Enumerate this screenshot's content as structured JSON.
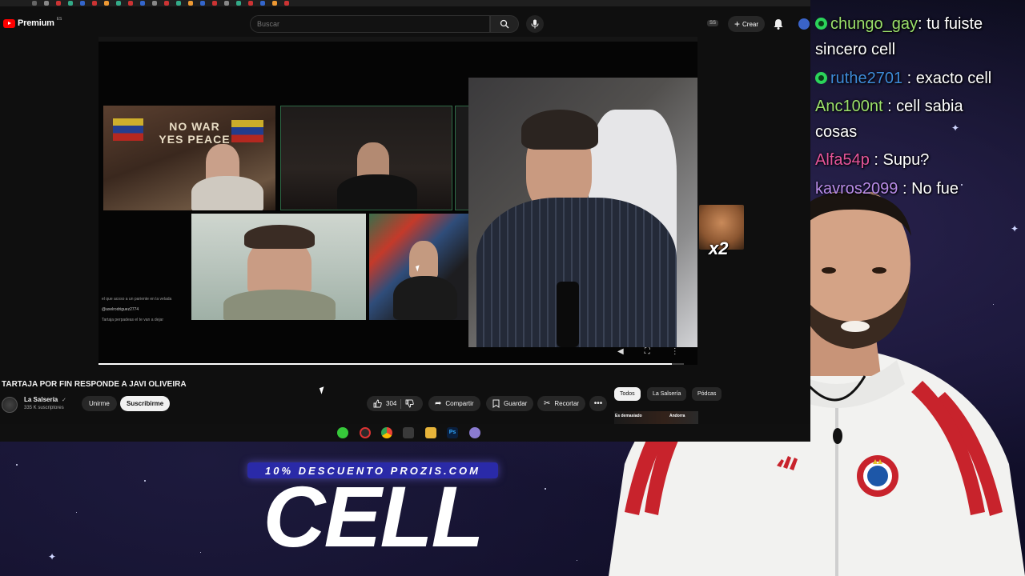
{
  "browser": {
    "youtube": {
      "brand": "Premium",
      "region": "ES",
      "search_placeholder": "Buscar",
      "ss_badge": "SS",
      "create_label": "Crear"
    },
    "video": {
      "overlay_text": "NO WAR\nYES PEACE",
      "mini_chat_line1": "el que acoso a un pariente en la velada",
      "mini_chat_user": "@axelrodriguez2774",
      "mini_chat_line2": "Tartaja perpadeas el te van a dejar",
      "progress": 0.98,
      "emote_multiplier": "x2"
    },
    "watch": {
      "title": "TARTAJA POR FIN RESPONDE A JAVI OLIVEIRA",
      "channel_name": "La Salsería",
      "verified_mark": "✓",
      "subscribers": "335 K suscriptores",
      "join_label": "Unirme",
      "subscribe_label": "Suscribirme",
      "likes": "304",
      "share_label": "Compartir",
      "save_label": "Guardar",
      "clip_label": "Recortar",
      "chips": [
        "Todos",
        "La Salsería",
        "Pódcas"
      ],
      "thumb_text1": "Es demasiado",
      "thumb_text2": "Andorra"
    }
  },
  "promo": {
    "banner": "10% DESCUENTO PROZIS.COM",
    "logo": "CELL"
  },
  "chat": {
    "messages": [
      {
        "user": "chungo_gay",
        "user_color": "#9be06a",
        "text": ": tu fuiste",
        "badge": true
      },
      {
        "user": "",
        "user_color": "#ffffff",
        "text": "sincero cell",
        "badge": false
      },
      {
        "user": "ruthe2701",
        "user_color": "#3e8bd9",
        "text": " : exacto cell",
        "badge": true
      },
      {
        "user": "Anc100nt",
        "user_color": "#9be06a",
        "text": " : cell sabia",
        "badge": false
      },
      {
        "user": "",
        "user_color": "#ffffff",
        "text": "cosas",
        "badge": false
      },
      {
        "user": "Alfa54p",
        "user_color": "#e6559a",
        "text": " : Supu?",
        "badge": false
      },
      {
        "user": "kavros2099",
        "user_color": "#b98ce8",
        "text": " : No fue",
        "badge": false
      }
    ]
  }
}
